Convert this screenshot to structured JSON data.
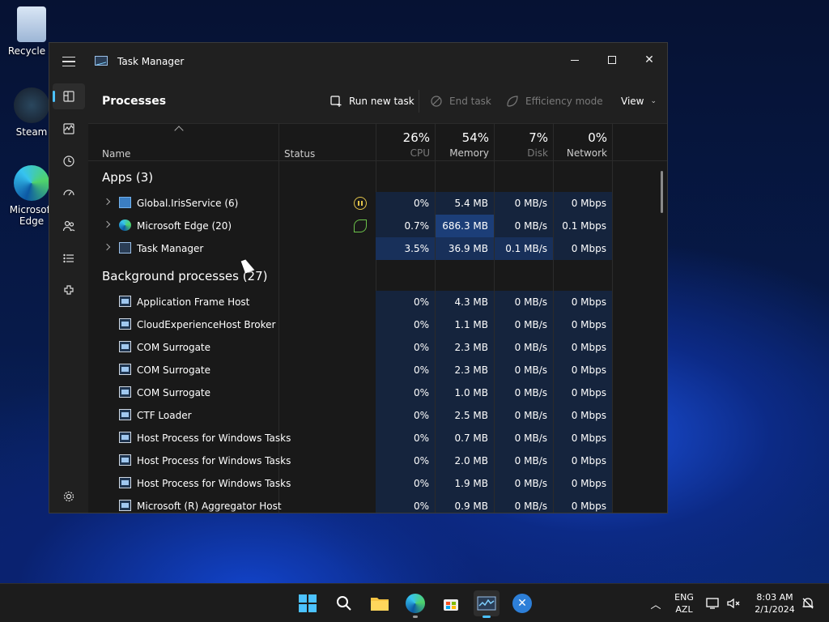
{
  "desktop": {
    "icons": [
      {
        "label": "Recycle B"
      },
      {
        "label": "Steam"
      },
      {
        "label": "Microsoft Edge"
      }
    ]
  },
  "window": {
    "title": "Task Manager",
    "page_title": "Processes",
    "commands": {
      "run_new_task": "Run new task",
      "end_task": "End task",
      "efficiency_mode": "Efficiency mode",
      "view": "View"
    },
    "columns": {
      "name": "Name",
      "status": "Status",
      "cpu": {
        "pct": "26%",
        "label": "CPU"
      },
      "memory": {
        "pct": "54%",
        "label": "Memory"
      },
      "disk": {
        "pct": "7%",
        "label": "Disk"
      },
      "network": {
        "pct": "0%",
        "label": "Network"
      }
    },
    "groups": {
      "apps": "Apps (3)",
      "background": "Background processes (27)"
    },
    "apps": [
      {
        "name": "Global.IrisService (6)",
        "status": "paused",
        "cpu": "0%",
        "memory": "5.4 MB",
        "disk": "0 MB/s",
        "network": "0 Mbps"
      },
      {
        "name": "Microsoft Edge (20)",
        "status": "efficiency",
        "cpu": "0.7%",
        "memory": "686.3 MB",
        "disk": "0 MB/s",
        "network": "0.1 Mbps"
      },
      {
        "name": "Task Manager",
        "status": "",
        "cpu": "3.5%",
        "memory": "36.9 MB",
        "disk": "0.1 MB/s",
        "network": "0 Mbps"
      }
    ],
    "background": [
      {
        "name": "Application Frame Host",
        "cpu": "0%",
        "memory": "4.3 MB",
        "disk": "0 MB/s",
        "network": "0 Mbps"
      },
      {
        "name": "CloudExperienceHost Broker",
        "cpu": "0%",
        "memory": "1.1 MB",
        "disk": "0 MB/s",
        "network": "0 Mbps"
      },
      {
        "name": "COM Surrogate",
        "cpu": "0%",
        "memory": "2.3 MB",
        "disk": "0 MB/s",
        "network": "0 Mbps"
      },
      {
        "name": "COM Surrogate",
        "cpu": "0%",
        "memory": "2.3 MB",
        "disk": "0 MB/s",
        "network": "0 Mbps"
      },
      {
        "name": "COM Surrogate",
        "cpu": "0%",
        "memory": "1.0 MB",
        "disk": "0 MB/s",
        "network": "0 Mbps"
      },
      {
        "name": "CTF Loader",
        "cpu": "0%",
        "memory": "2.5 MB",
        "disk": "0 MB/s",
        "network": "0 Mbps"
      },
      {
        "name": "Host Process for Windows Tasks",
        "cpu": "0%",
        "memory": "0.7 MB",
        "disk": "0 MB/s",
        "network": "0 Mbps"
      },
      {
        "name": "Host Process for Windows Tasks",
        "cpu": "0%",
        "memory": "2.0 MB",
        "disk": "0 MB/s",
        "network": "0 Mbps"
      },
      {
        "name": "Host Process for Windows Tasks",
        "cpu": "0%",
        "memory": "1.9 MB",
        "disk": "0 MB/s",
        "network": "0 Mbps"
      },
      {
        "name": "Microsoft (R) Aggregator Host",
        "cpu": "0%",
        "memory": "0.9 MB",
        "disk": "0 MB/s",
        "network": "0 Mbps"
      }
    ]
  },
  "taskbar": {
    "apps": [
      "start",
      "search",
      "file-explorer",
      "edge",
      "store",
      "task-manager",
      "other-app"
    ],
    "language": "ENG",
    "keyboard": "AZL",
    "time": "8:03 AM",
    "date": "2/1/2024"
  },
  "colors": {
    "accent": "#4cc2ff",
    "window_bg": "#202020",
    "heat_low": "#15243d",
    "heat_mid": "#18305a",
    "heat_high": "#1c3e78"
  }
}
